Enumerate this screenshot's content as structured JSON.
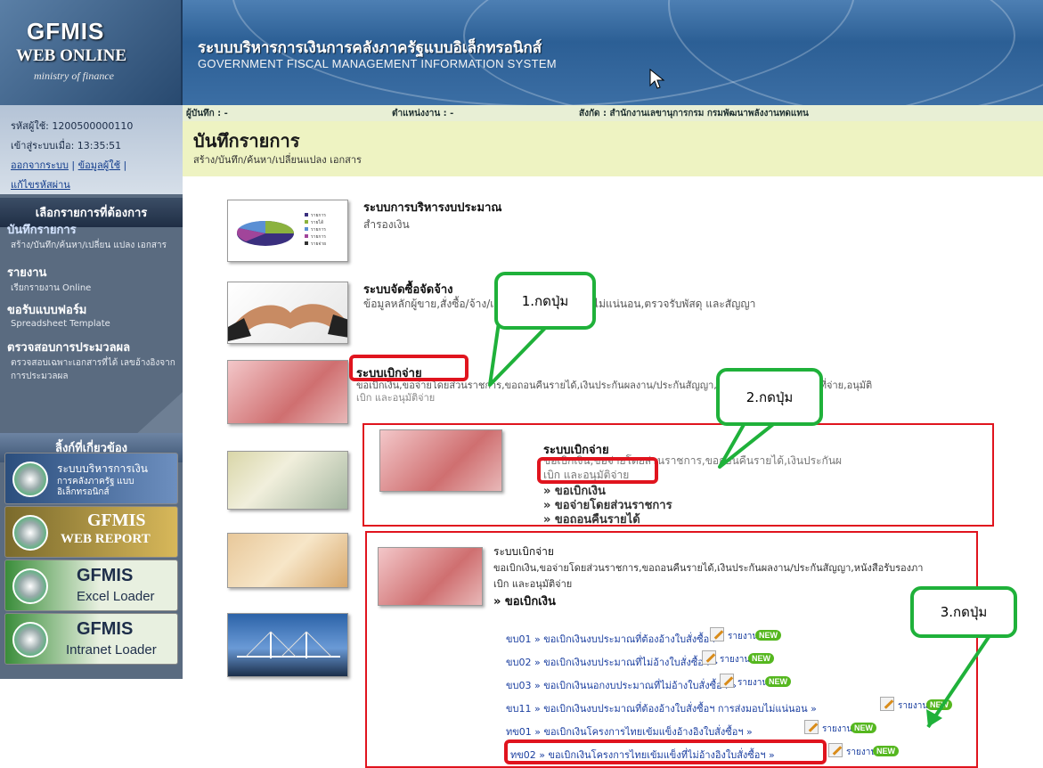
{
  "header": {
    "logo_line1": "GFMIS",
    "logo_line2": "WEB ONLINE",
    "logo_line3": "ministry of finance",
    "title_th": "ระบบบริหารการเงินการคลังภาครัฐแบบอิเล็กทรอนิกส์",
    "title_en": "GOVERNMENT FISCAL MANAGEMENT INFORMATION SYSTEM"
  },
  "user": {
    "user_id": "รหัสผู้ใช้: 1200500000110",
    "login_time": "เข้าสู่ระบบเมื่อ: 13:35:51",
    "logout_link": "ออกจากระบบ",
    "profile_link": "ข้อมูลผู้ใช้",
    "password_link": "แก้ไขรหัสผ่าน"
  },
  "sidebar": {
    "menu_header": "เลือกรายการที่ต้องการ",
    "items": [
      {
        "title": "บันทึกรายการ",
        "sub": "สร้าง/บันทึก/ค้นหา/เปลี่ยน แปลง เอกสาร"
      },
      {
        "title": "รายงาน",
        "sub": "เรียกรายงาน Online"
      },
      {
        "title": "ขอรับแบบฟอร์ม",
        "sub": "Spreadsheet Template"
      },
      {
        "title": "ตรวจสอบการประมวลผล",
        "sub": "ตรวจสอบเฉพาะเอกสารที่ได้ เลขอ้างอิงจากการประมวลผล"
      }
    ],
    "related_header": "ลิ้งก์ที่เกี่ยวข้อง",
    "banners": [
      {
        "line1": "ระบบบริหารการเงิน",
        "line2": "การคลังภาครัฐ แบบอิเล็กทรอนิกส์"
      },
      {
        "line1": "GFMIS",
        "line2": "WEB REPORT"
      },
      {
        "line1": "GFMIS",
        "line2": "Excel Loader"
      },
      {
        "line1": "GFMIS",
        "line2": "Intranet Loader"
      }
    ]
  },
  "infobar": {
    "recorder": "ผู้บันทึก : -",
    "position": "ตำแหน่งงาน : -",
    "affiliation": "สังกัด : สำนักงานเลขานุการกรม กรมพัฒนาพลังงานทดแทน"
  },
  "page": {
    "title": "บันทึกรายการ",
    "subtitle": "สร้าง/บันทึก/ค้นหา/เปลี่ยนแปลง เอกสาร"
  },
  "systems": {
    "budget_title": "ระบบการบริหารงบประมาณ",
    "budget_desc": "สำรองเงิน",
    "budget_legend": [
      "รายการ",
      "รายได้",
      "รายการ",
      "รายการ",
      "รายจ่าย"
    ],
    "procure_title": "ระบบจัดซื้อจัดจ้าง",
    "procure_desc": "ข้อมูลหลักผู้ขาย,สั่งซื้อ/จ้าง/เช่าประเภทการส่งมอบไม่แน่นอน,ตรวจรับพัสดุ และสัญญา",
    "disburse_title": "ระบบเบิกจ่าย",
    "disburse_desc": "ขอเบิกเงิน,ขอจ่ายโดยส่วนราชการ,ขอถอนคืนรายได้,เงินประกันผลงาน/ประกันสัญญา,หนังสือรับรองภาษีหัก ณ ที่จ่าย,อนุมัติ",
    "disburse_desc2": "เบิก และอนุมัติจ่าย"
  },
  "box2": {
    "title": "ระบบเบิกจ่าย",
    "desc": "ขอเบิกเงิน,ขอจ่ายโดยส่วนราชการ,ขอถอนคืนรายได้,เงินประกันผ",
    "desc2": "เบิก และอนุมัติจ่าย",
    "links": [
      "» ขอเบิกเงิน",
      "» ขอจ่ายโดยส่วนราชการ",
      "» ขอถอนคืนรายได้"
    ]
  },
  "box3": {
    "title": "ระบบเบิกจ่าย",
    "desc": "ขอเบิกเงิน,ขอจ่ายโดยส่วนราชการ,ขอถอนคืนรายได้,เงินประกันผลงาน/ประกันสัญญา,หนังสือรับรองภา",
    "desc2": "เบิก และอนุมัติจ่าย",
    "section": "» ขอเบิกเงิน",
    "report_label": "รายงาน",
    "new_label": "NEW",
    "links": [
      "ขบ01 » ขอเบิกเงินงบประมาณที่ต้องอ้างใบสั่งซื้อฯ »",
      "ขบ02 » ขอเบิกเงินงบประมาณที่ไม่อ้างใบสั่งซื้อฯ »",
      "ขบ03 » ขอเบิกเงินนอกงบประมาณที่ไม่อ้างใบสั่งซื้อฯ »",
      "ขบ11 » ขอเบิกเงินงบประมาณที่ต้องอ้างใบสั่งซื้อฯ การส่งมอบไม่แน่นอน »",
      "ทข01 » ขอเบิกเงินโครงการไทยเข้มแข็งอ้างอิงใบสั่งซื้อฯ »",
      "ทข02 » ขอเบิกเงินโครงการไทยเข้มแข็งที่ไม่อ้างอิงใบสั่งซื้อฯ »"
    ]
  },
  "callouts": {
    "step1": "1.กดปุ่ม",
    "step2": "2.กดปุ่ม",
    "step3": "3.กดปุ่ม"
  },
  "colors": {
    "highlight": "#e0141e",
    "callout": "#1fb13a"
  }
}
